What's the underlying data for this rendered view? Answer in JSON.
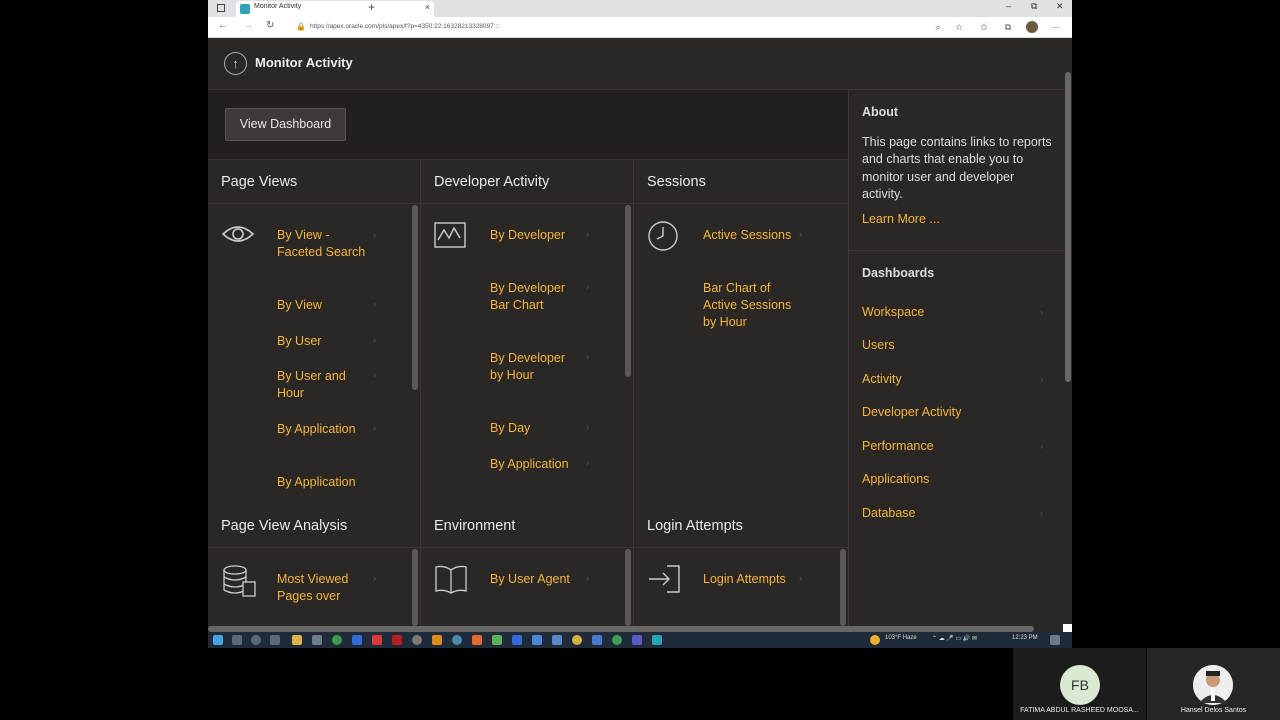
{
  "browser": {
    "tab_title": "Monitor Activity",
    "url": "https://apex.oracle.com/pls/apex/f?p=4350:22:16328213328097:::",
    "new_tab": "+",
    "close_tab": "×",
    "minimize": "–",
    "maximize": "⧉",
    "close": "✕"
  },
  "page": {
    "title": "Monitor Activity",
    "view_dashboard": "View Dashboard"
  },
  "cards": {
    "page_views": {
      "title": "Page Views",
      "links": [
        "By View - Faceted Search",
        "By View",
        "By User",
        "By User and Hour",
        "By Application",
        "By Application"
      ]
    },
    "developer_activity": {
      "title": "Developer Activity",
      "links": [
        "By Developer",
        "By Developer Bar Chart",
        "By Developer by Hour",
        "By Day",
        "By Application"
      ]
    },
    "sessions": {
      "title": "Sessions",
      "links": [
        "Active Sessions",
        "Bar Chart of Active Sessions by Hour"
      ]
    },
    "page_view_analysis": {
      "title": "Page View Analysis",
      "links": [
        "Most Viewed Pages over"
      ]
    },
    "environment": {
      "title": "Environment",
      "links": [
        "By User Agent"
      ]
    },
    "login_attempts": {
      "title": "Login Attempts",
      "links": [
        "Login Attempts"
      ]
    }
  },
  "sidebar": {
    "about_heading": "About",
    "about_text": "This page contains links to reports and charts that enable you to monitor user and developer activity.",
    "learn_more": "Learn More ...",
    "dashboards_heading": "Dashboards",
    "dashboards": [
      "Workspace",
      "Users",
      "Activity",
      "Developer Activity",
      "Performance",
      "Applications",
      "Database"
    ]
  },
  "taskbar": {
    "weather": "103°F Haze",
    "time": "12:23 PM"
  },
  "participants": [
    {
      "initials": "FB",
      "name": "FATIMA ABDUL RASHEED MOOSA..."
    },
    {
      "initials": "",
      "name": "Hansel Delos Santos"
    }
  ],
  "colors": {
    "link": "#f2b63e",
    "background": "#2b2725"
  }
}
